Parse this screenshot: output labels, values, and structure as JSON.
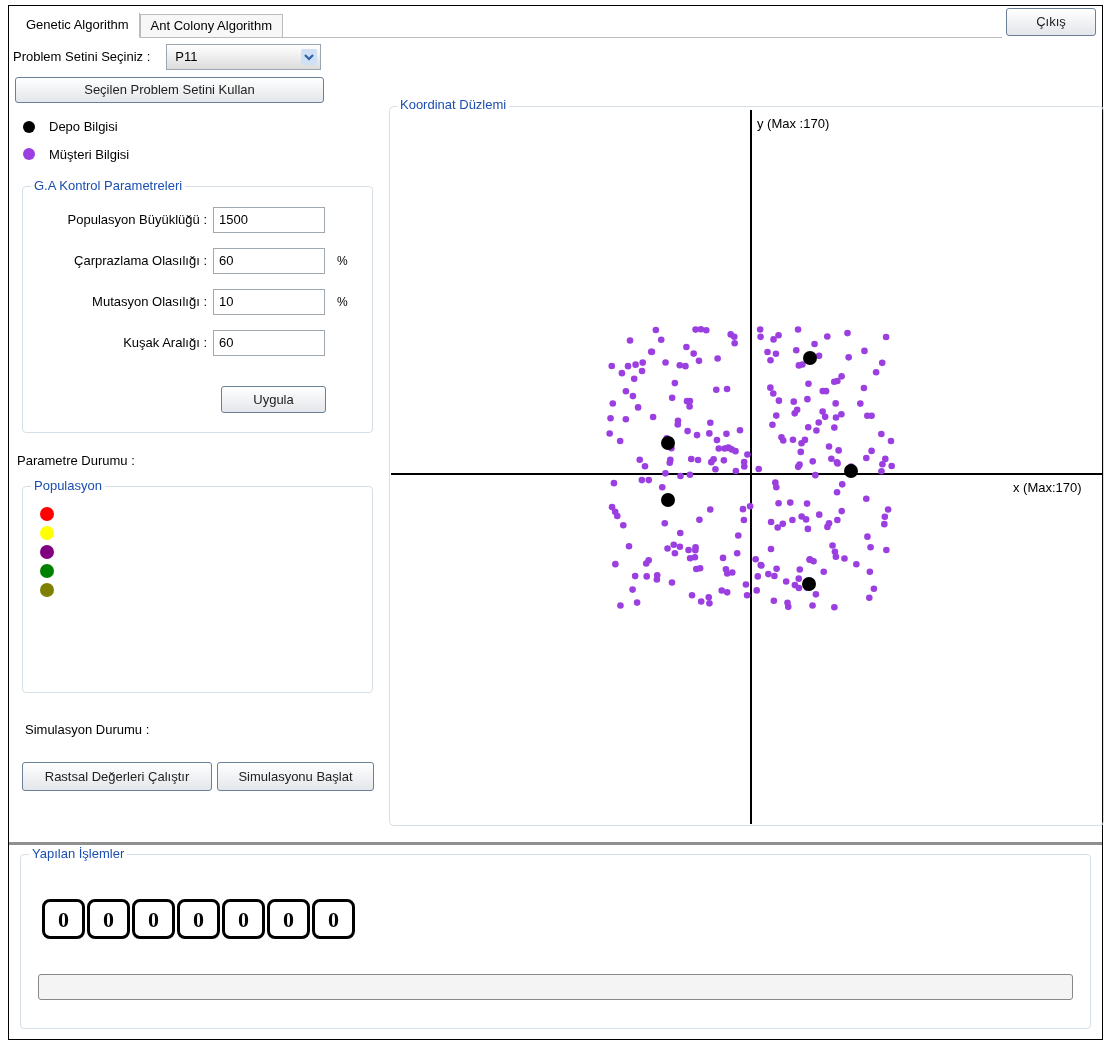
{
  "tabs": [
    {
      "label": "Genetic Algorithm",
      "selected": true
    },
    {
      "label": "Ant Colony Algorithm",
      "selected": false
    }
  ],
  "exit_button": "Çıkış",
  "problem_set": {
    "label": "Problem Setini Seçiniz :",
    "value": "P11"
  },
  "use_button": "Seçilen Problem Setini Kullan",
  "legend": [
    {
      "label": "Depo Bilgisi",
      "color": "#000000"
    },
    {
      "label": "Müşteri Bilgisi",
      "color": "#9b3fe0"
    }
  ],
  "ga_params": {
    "title": "G.A Kontrol Parametreleri",
    "fields": [
      {
        "label": "Populasyon Büyüklüğü :",
        "value": "1500"
      },
      {
        "label": "Çarprazlama Olasılığı :",
        "value": "60",
        "unit": "%"
      },
      {
        "label": "Mutasyon Olasılığı :",
        "value": "10",
        "unit": "%"
      },
      {
        "label": "Kuşak Aralığı :",
        "value": "60"
      }
    ],
    "apply_button": "Uygula"
  },
  "parameter_status": "Parametre Durumu :",
  "population": {
    "title": "Populasyon",
    "markers": [
      {
        "color": "#ff0000"
      },
      {
        "color": "#ffff00"
      },
      {
        "color": "#800080"
      },
      {
        "color": "#008000"
      },
      {
        "color": "#808000"
      }
    ]
  },
  "simulation_status": "Simulasyon Durumu :",
  "buttons": [
    "Rastsal Değerleri Çalıştır",
    "Simulasyonu Başlat"
  ],
  "plane": {
    "title": "Koordinat Düzlemi",
    "y_label": "y (Max :170)",
    "x_label": "x (Max:170)"
  },
  "operations": {
    "title": "Yapılan İşlemler",
    "digits": [
      "0",
      "0",
      "0",
      "0",
      "0",
      "0",
      "0"
    ],
    "progress": {
      "level": 0
    }
  }
}
